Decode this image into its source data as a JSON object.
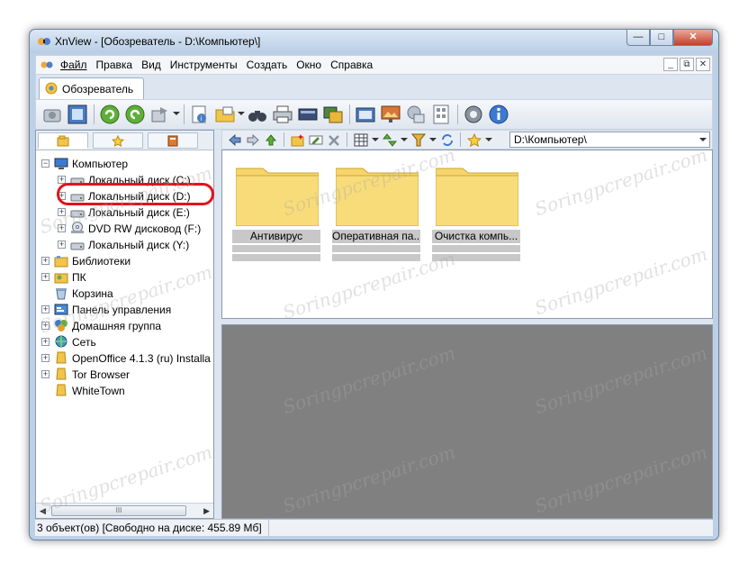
{
  "window": {
    "title": "XnView - [Обозреватель - D:\\Компьютер\\]"
  },
  "title_buttons": {
    "minimize": "—",
    "maximize": "□",
    "close": "✕"
  },
  "menu": {
    "items": [
      "Файл",
      "Правка",
      "Вид",
      "Инструменты",
      "Создать",
      "Окно",
      "Справка"
    ],
    "mdi": [
      "_",
      "⧉",
      "✕"
    ]
  },
  "tab": {
    "label": "Обозреватель"
  },
  "tree": {
    "items": [
      {
        "label": "Компьютер"
      },
      {
        "label": "Локальный диск (C:)"
      },
      {
        "label": "Локальный диск (D:)"
      },
      {
        "label": "Локальный диск (E:)"
      },
      {
        "label": "DVD RW дисковод (F:)"
      },
      {
        "label": "Локальный диск (Y:)"
      },
      {
        "label": "Библиотеки"
      },
      {
        "label": "ПК"
      },
      {
        "label": "Корзина"
      },
      {
        "label": "Панель управления"
      },
      {
        "label": "Домашняя группа"
      },
      {
        "label": "Сеть"
      },
      {
        "label": "OpenOffice 4.1.3 (ru) Installa"
      },
      {
        "label": "Tor Browser"
      },
      {
        "label": "WhiteTown"
      }
    ],
    "scroll_grip": "III"
  },
  "nav": {
    "path": "D:\\Компьютер\\"
  },
  "files": [
    {
      "name": "Антивирус"
    },
    {
      "name": "Оперативная па..."
    },
    {
      "name": "Очистка компь..."
    }
  ],
  "status": {
    "text": "3 объект(ов) [Свободно на диске: 455.89 Мб]"
  },
  "watermark": "Soringpcrepair.com",
  "colors": {
    "folder": "#f7d56b",
    "highlight": "#e0141b",
    "preview_bg": "#808080"
  }
}
